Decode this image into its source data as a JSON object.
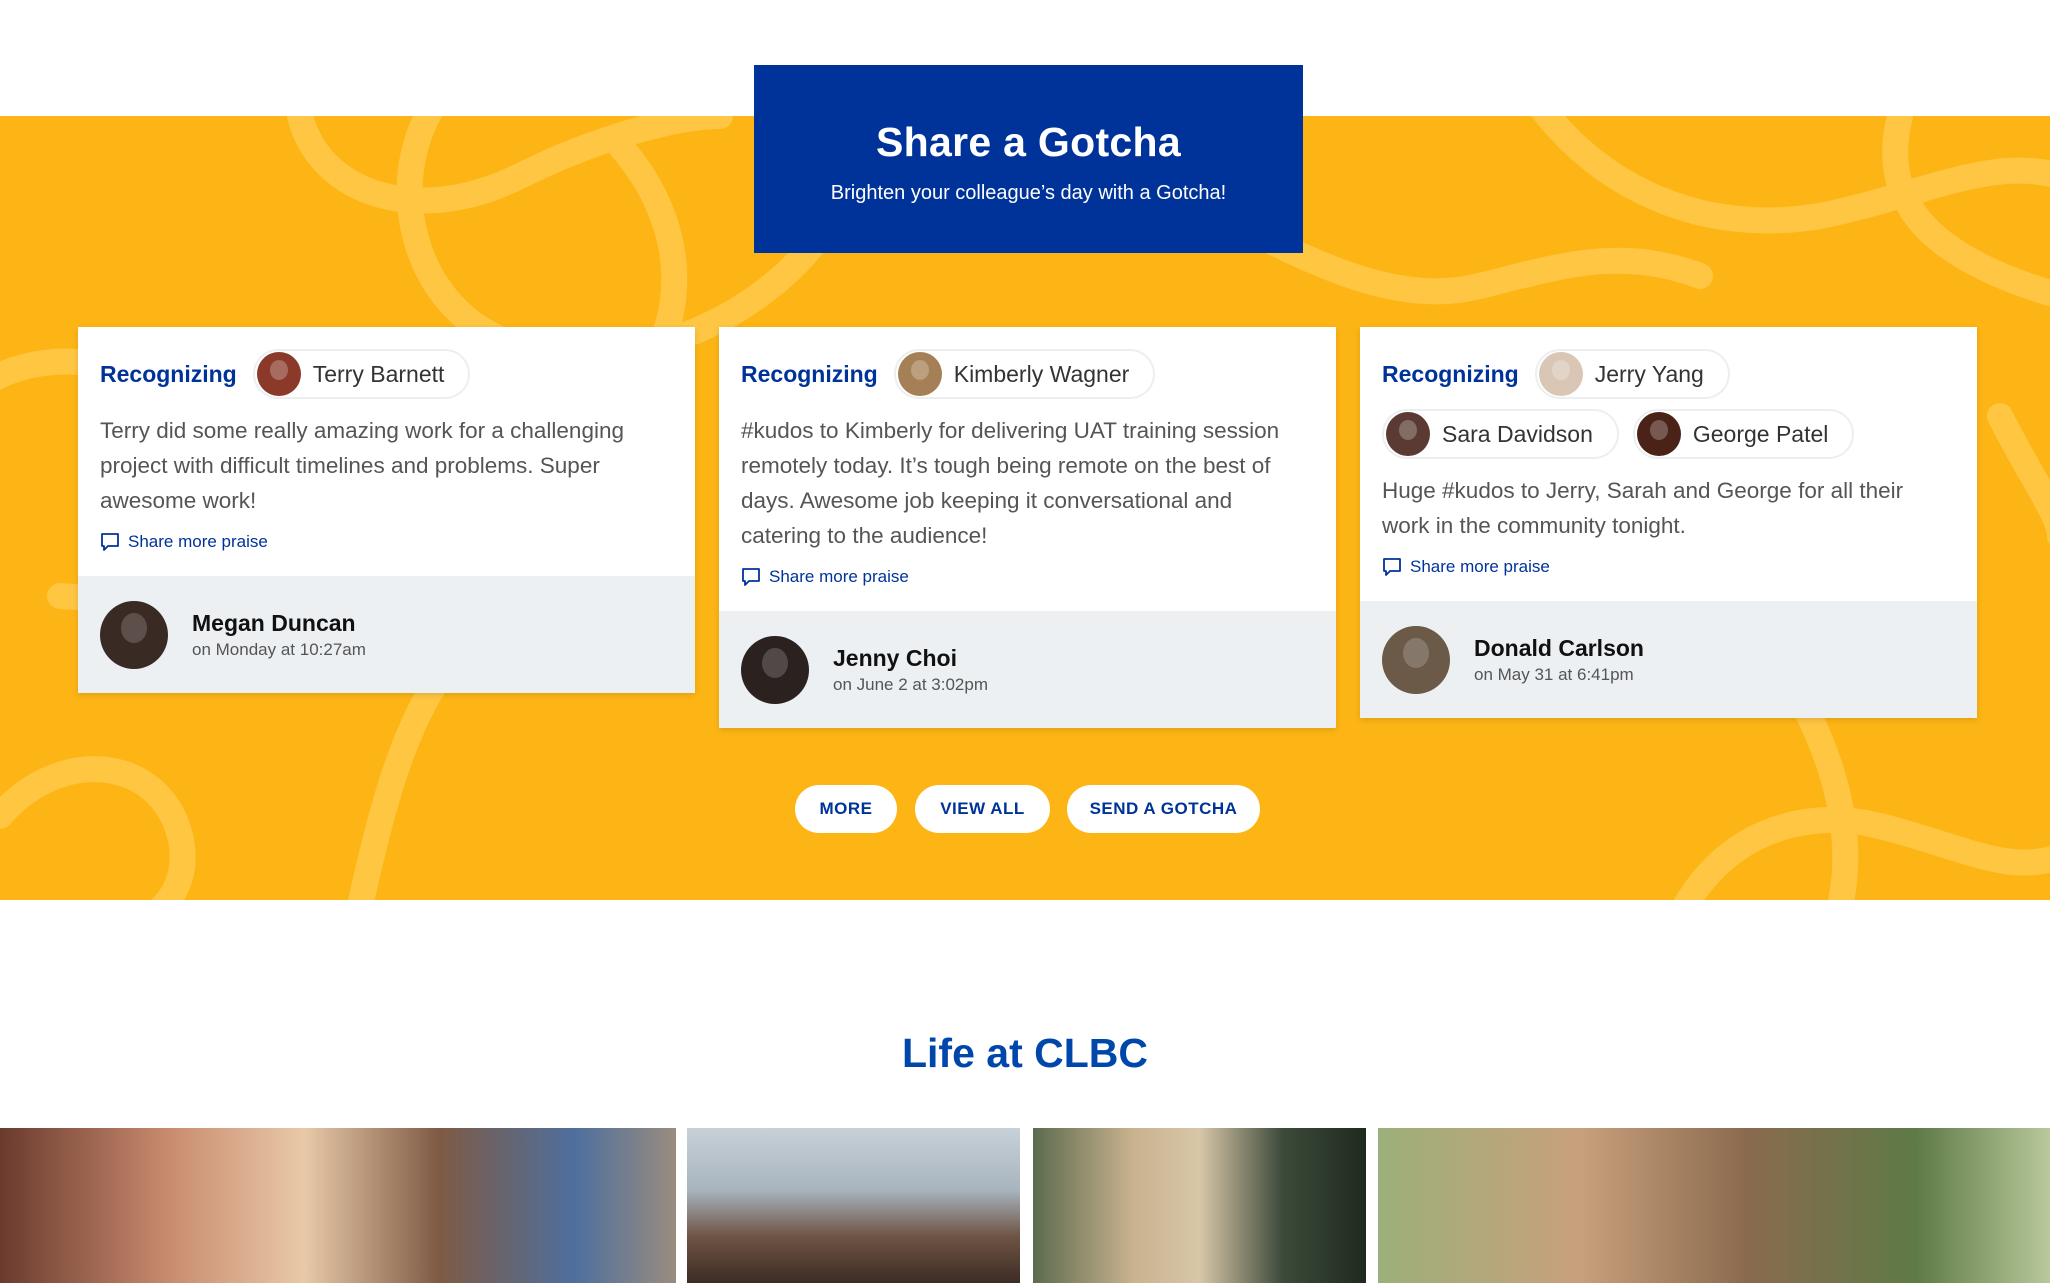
{
  "hero": {
    "title": "Share a Gotcha",
    "subtitle": "Brighten your colleague’s day with a Gotcha!"
  },
  "cards": [
    {
      "recognizing_label": "Recognizing",
      "recipients": [
        {
          "name": "Terry Barnett",
          "avatar_color": "#8B3A2A"
        }
      ],
      "message": "Terry did some really amazing work for a challenging project with difficult timelines and problems. Super awesome work!",
      "share_label": "Share more praise",
      "sender": {
        "name": "Megan Duncan",
        "time": "on Monday at 10:27am",
        "avatar_color": "#3A2A24"
      }
    },
    {
      "recognizing_label": "Recognizing",
      "recipients": [
        {
          "name": "Kimberly Wagner",
          "avatar_color": "#A57F55"
        }
      ],
      "message": "#kudos to Kimberly for delivering UAT training session remotely today. It’s tough being remote on the best of days. Awesome job keeping it conversational and catering to the audience!",
      "share_label": "Share more praise",
      "sender": {
        "name": "Jenny Choi",
        "time": "on June 2 at 3:02pm",
        "avatar_color": "#2B2220"
      }
    },
    {
      "recognizing_label": "Recognizing",
      "recipients": [
        {
          "name": "Jerry Yang",
          "avatar_color": "#D9C6B4"
        },
        {
          "name": "Sara Davidson",
          "avatar_color": "#5A3A33"
        },
        {
          "name": "George Patel",
          "avatar_color": "#4A2218"
        }
      ],
      "message": "Huge #kudos to Jerry, Sarah and George for all their work in the community tonight.",
      "share_label": "Share more praise",
      "sender": {
        "name": "Donald Carlson",
        "time": "on May 31 at 6:41pm",
        "avatar_color": "#6B5A48"
      }
    }
  ],
  "buttons": {
    "more": "MORE",
    "view_all": "VIEW ALL",
    "send": "SEND A GOTCHA"
  },
  "life_section": {
    "title": "Life at CLBC"
  },
  "colors": {
    "brand_blue": "#003399",
    "title_blue": "#0047AB",
    "yellow": "#FDB515",
    "card_footer": "#ECF0F3"
  }
}
